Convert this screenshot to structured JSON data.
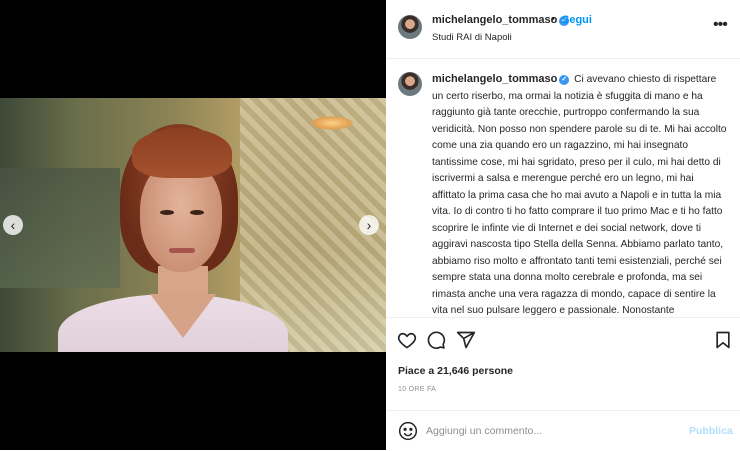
{
  "colors": {
    "accent": "#0095f6",
    "verified": "#3897f0",
    "muted": "#8e8e8e",
    "publish_disabled": "#b2dffc"
  },
  "media": {
    "photo_alt": "photo-of-woman",
    "prev_icon": "chevron-left-icon",
    "next_icon": "chevron-right-icon",
    "prev_glyph": "‹",
    "next_glyph": "›"
  },
  "header": {
    "username": "michelangelo_tommaso",
    "verified_glyph": "✓",
    "separator": "•",
    "follow_label": "Segui",
    "location": "Studi RAI di Napoli",
    "more_glyph": "•••"
  },
  "caption": {
    "username": "michelangelo_tommaso",
    "verified_glyph": "✓",
    "text": "Ci avevano chiesto di rispettare un certo riserbo, ma ormai la notizia è sfuggita di mano e ha raggiunto già tante orecchie, purtroppo confermando la sua veridicità. Non posso non spendere parole su di te. Mi hai accolto come una zia quando ero un ragazzino, mi hai insegnato tantissime cose, mi hai sgridato, preso per il culo, mi hai detto di iscrivermi a salsa e merengue perché ero un legno, mi hai affittato la prima casa che ho mai avuto a Napoli e in tutta la mia vita. Io di contro ti ho fatto comprare il tuo primo Mac e ti ho fatto scoprire le infinte vie di Internet e dei social network, dove ti aggiravi nascosta tipo Stella della Senna. Abbiamo parlato tanto, abbiamo riso molto e affrontato tanti temi esistenziali, perché sei sempre stata una donna molto cerebrale e profonda, ma sei rimasta anche una vera ragazza di mondo, capace di sentire la vita nel suo pulsare leggero e passionale. Nonostante passassero gli anni, dentro di te sei rimasta quella giovane che si sentiva ancora piena di voglia di vivere e sognare"
  },
  "actions": {
    "like_icon": "heart-icon",
    "comment_icon": "comment-icon",
    "share_icon": "share-icon",
    "save_icon": "bookmark-icon"
  },
  "stats": {
    "likes": "Piace a 21,646 persone",
    "time": "10 ORE FA"
  },
  "add_comment": {
    "emoji_icon": "emoji-icon",
    "placeholder": "Aggiungi un commento...",
    "publish_label": "Pubblica"
  }
}
